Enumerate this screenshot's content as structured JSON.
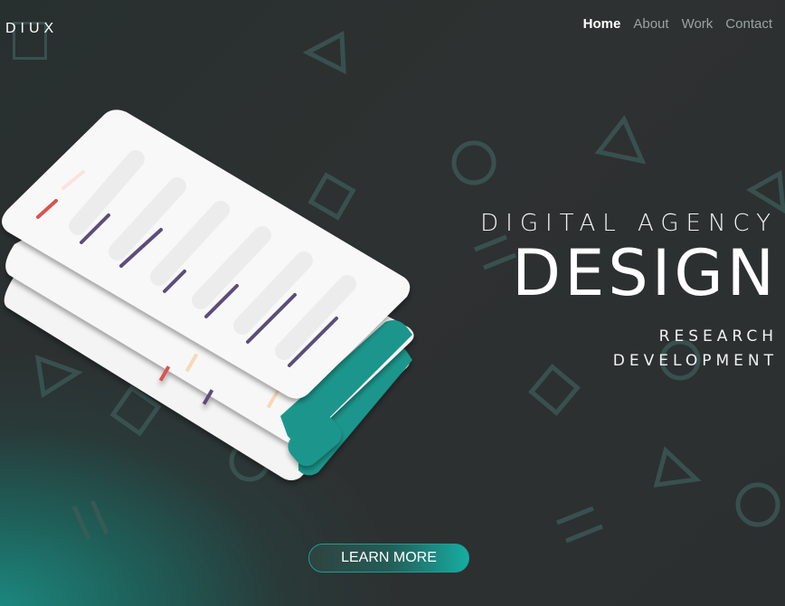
{
  "brand": {
    "logo_text": "DIUX"
  },
  "nav": {
    "items": [
      {
        "label": "Home",
        "active": true
      },
      {
        "label": "About",
        "active": false
      },
      {
        "label": "Work",
        "active": false
      },
      {
        "label": "Contact",
        "active": false
      }
    ]
  },
  "hero": {
    "tagline": "DIGITAL AGENCY",
    "headline": "DESIGN",
    "sub_line_1": "RESEARCH",
    "sub_line_2": "DEVELOPMENT"
  },
  "cta": {
    "label": "LEARN MORE"
  },
  "colors": {
    "accent": "#1a968c",
    "bar_purple": "#5b4e7a",
    "bar_red": "#d9534f",
    "bar_peach": "#f6d9b7",
    "card": "#f7f7f7"
  },
  "icons": [
    "triangle-outline-icon",
    "circle-outline-icon",
    "square-outline-icon",
    "double-line-icon"
  ]
}
